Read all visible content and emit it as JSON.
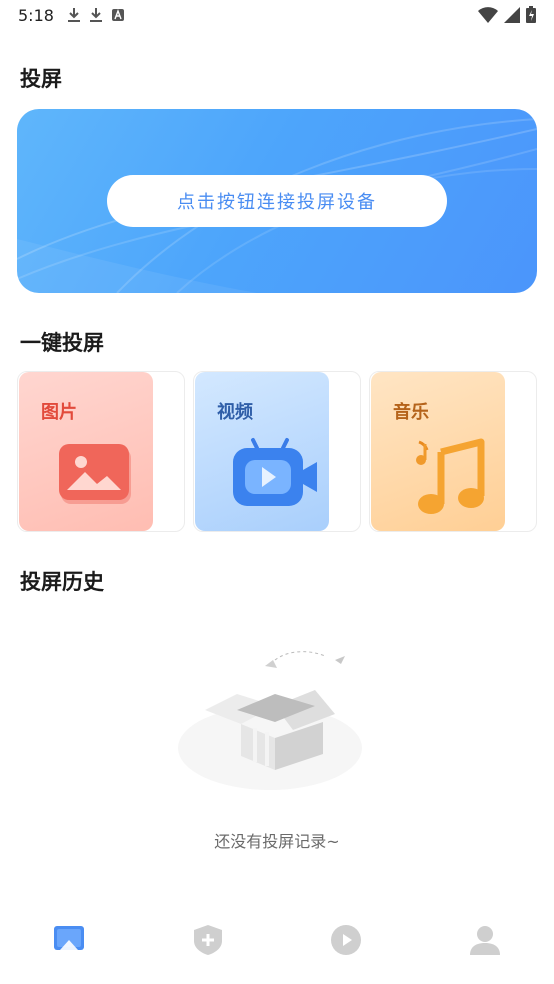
{
  "status_bar": {
    "time": "5:18",
    "left_icons": [
      "download-icon",
      "download-icon",
      "font-icon"
    ],
    "right_icons": [
      "wifi-icon",
      "signal-icon",
      "battery-icon"
    ]
  },
  "cast": {
    "title": "投屏",
    "connect_button": "点击按钮连接投屏设备"
  },
  "quick_cast": {
    "title": "一键投屏",
    "cards": [
      {
        "label": "图片",
        "icon": "image-icon",
        "color": "#e24a3b"
      },
      {
        "label": "视频",
        "icon": "video-icon",
        "color": "#2f5ea8"
      },
      {
        "label": "音乐",
        "icon": "music-icon",
        "color": "#b5631b"
      }
    ]
  },
  "history": {
    "title": "投屏历史",
    "empty_text": "还没有投屏记录~"
  },
  "bottom_nav": {
    "items": [
      {
        "icon": "cast-icon",
        "active": true
      },
      {
        "icon": "shield-plus-icon",
        "active": false
      },
      {
        "icon": "play-icon",
        "active": false
      },
      {
        "icon": "user-icon",
        "active": false
      }
    ],
    "active_color": "#4a8df2",
    "inactive_color": "#cfcfcf"
  }
}
